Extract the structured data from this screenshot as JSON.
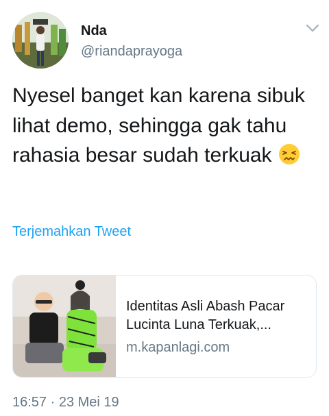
{
  "user": {
    "display_name": "Nda",
    "handle": "@riandaprayoga",
    "avatar_icon": "profile-photo",
    "menu_icon": "chevron-down-icon"
  },
  "tweet": {
    "text": "Nyesel banget kan karena sibuk lihat demo, sehingga gak tahu rahasia besar sudah terkuak",
    "emoji": "confounded-face-emoji",
    "translate_label": "Terjemahkan Tweet"
  },
  "card": {
    "title": "Identitas Asli Abash Pacar Lucinta Luna Terkuak,...",
    "domain": "m.kapanlagi.com"
  },
  "meta": {
    "timestamp": "16:57 · 23 Mei 19"
  },
  "colors": {
    "link": "#1da1f2",
    "secondary_text": "#657786",
    "border": "#e1e8ed"
  }
}
